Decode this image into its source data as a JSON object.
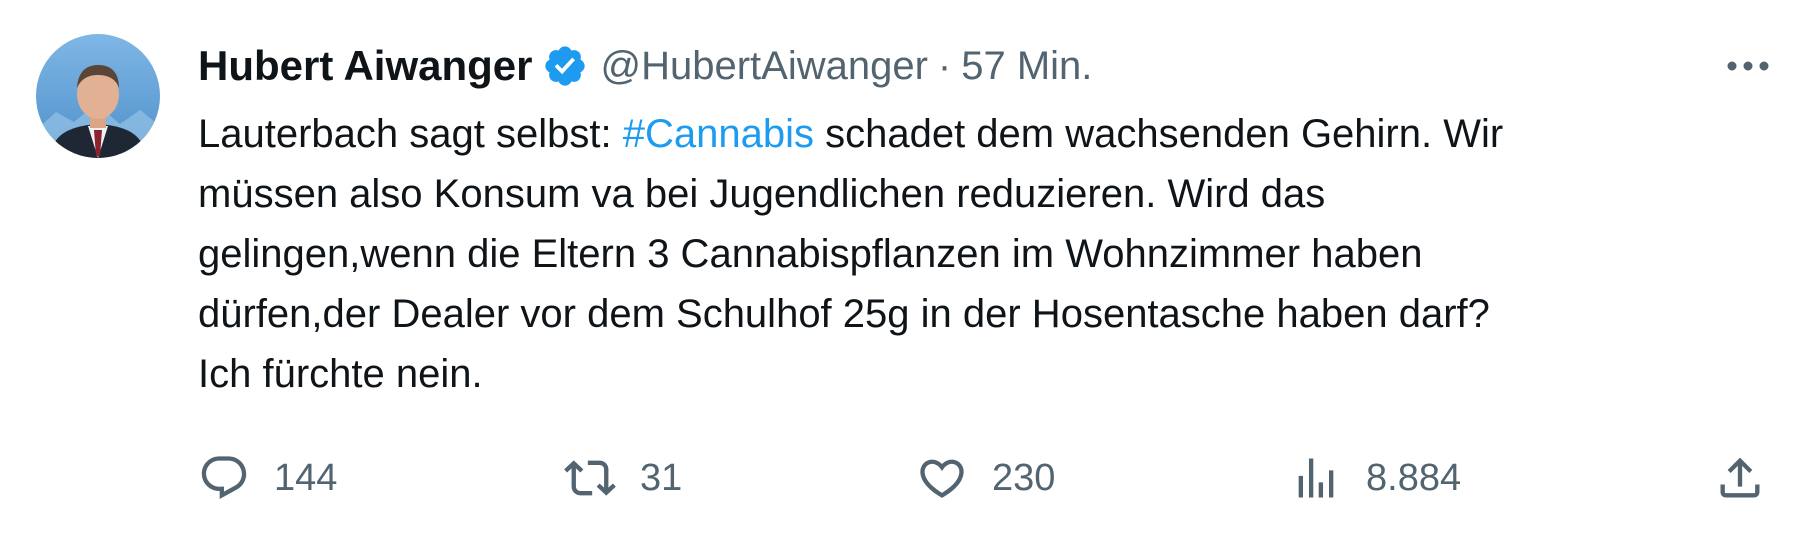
{
  "author": {
    "display_name": "Hubert Aiwanger",
    "handle": "@HubertAiwanger",
    "separator": "·",
    "time": "57 Min.",
    "verified": true
  },
  "tweet": {
    "line1_before": "Lauterbach sagt selbst: ",
    "hashtag": "#Cannabis",
    "line1_after": " schadet dem wachsenden Gehirn. Wir",
    "line2": "müssen also Konsum va bei Jugendlichen reduzieren. Wird das",
    "line3": "gelingen,wenn die Eltern 3 Cannabispflanzen im Wohnzimmer haben",
    "line4": "dürfen,der Dealer vor dem Schulhof 25g in der Hosentasche haben darf?",
    "line5": "Ich fürchte nein."
  },
  "actions": {
    "replies": "144",
    "retweets": "31",
    "likes": "230",
    "views": "8.884"
  },
  "icons": {
    "avatar": "avatar-photo",
    "verified": "verified-badge-icon",
    "more": "more-options-icon",
    "reply": "reply-icon",
    "retweet": "retweet-icon",
    "like": "heart-icon",
    "views": "views-chart-icon",
    "share": "share-icon"
  },
  "colors": {
    "text": "#0f1419",
    "secondary": "#536471",
    "accent": "#1d9bf0"
  }
}
